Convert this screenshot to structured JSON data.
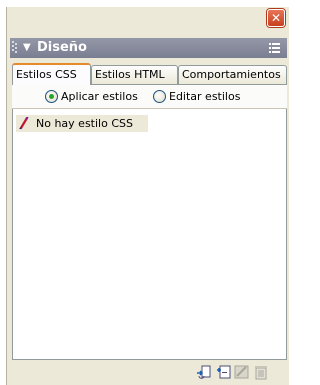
{
  "window": {
    "close_icon": "close-icon",
    "close_color": "#d9532c"
  },
  "panel": {
    "title": "Diseño",
    "header_color": "#84889a",
    "options_icon": "options-menu-icon"
  },
  "tabs": [
    {
      "label": "Estilos CSS",
      "active": true
    },
    {
      "label": "Estilos HTML",
      "active": false
    },
    {
      "label": "Comportamientos",
      "active": false
    }
  ],
  "style_mode": {
    "options": [
      {
        "label": "Aplicar estilos",
        "selected": true
      },
      {
        "label": "Editar estilos",
        "selected": false
      }
    ]
  },
  "styles_list": {
    "items": [
      {
        "label": "No hay estilo CSS",
        "icon": "css-style-icon"
      }
    ]
  },
  "toolbar": {
    "icons": [
      "attach-style-sheet-icon",
      "new-style-icon",
      "edit-style-icon",
      "delete-style-icon"
    ]
  }
}
